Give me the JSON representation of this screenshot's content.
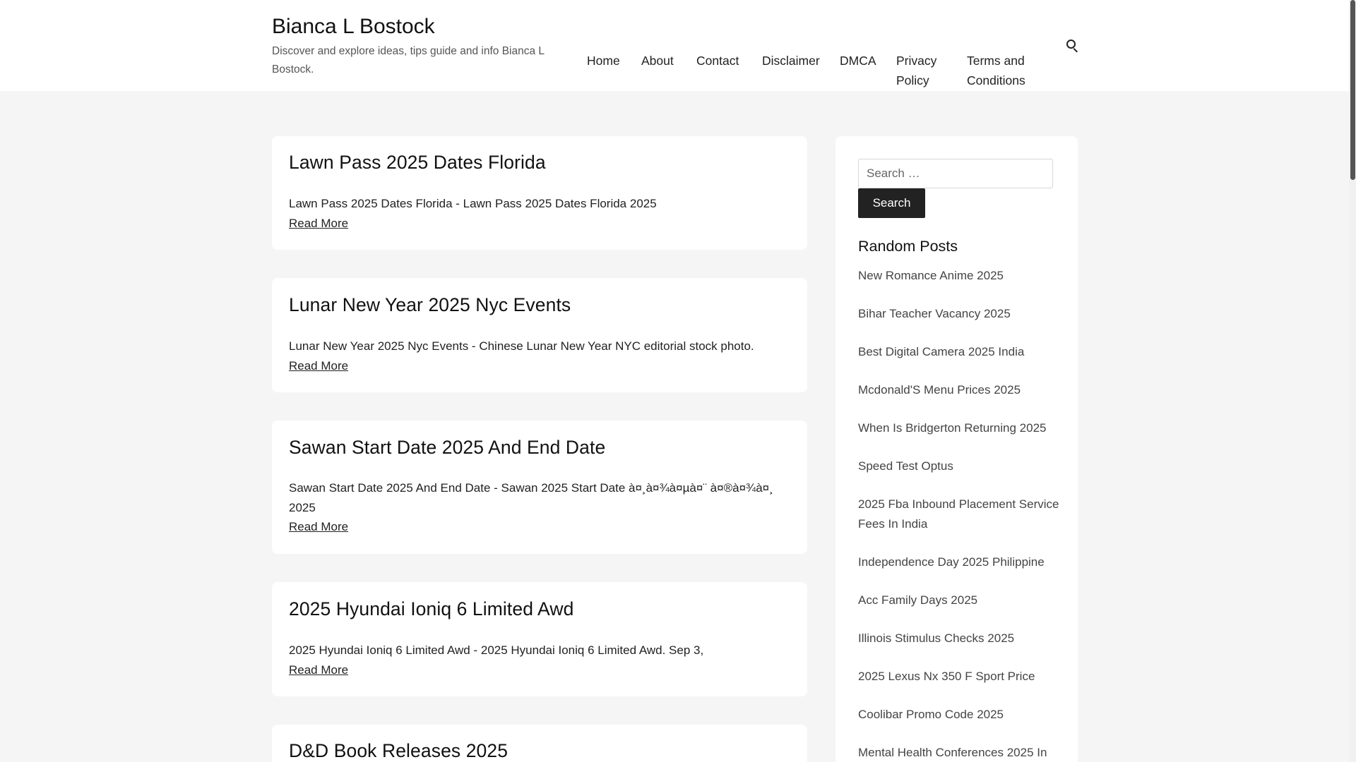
{
  "site": {
    "title": "Bianca L Bostock",
    "tagline": "Discover and explore ideas, tips guide and info Bianca L Bostock."
  },
  "nav": {
    "home": "Home",
    "about": "About",
    "contact": "Contact",
    "disclaimer": "Disclaimer",
    "dmca": "DMCA",
    "privacy": "Privacy Policy",
    "terms": "Terms and Conditions",
    "search_icon": "search-icon"
  },
  "posts": [
    {
      "title": "Lawn Pass 2025 Dates Florida",
      "excerpt": "Lawn Pass 2025 Dates Florida - Lawn Pass 2025 Dates Florida 2025",
      "read_more": "Read More"
    },
    {
      "title": "Lunar New Year 2025 Nyc Events",
      "excerpt": "Lunar New Year 2025 Nyc Events - Chinese Lunar New Year NYC editorial stock photo.",
      "read_more": "Read More"
    },
    {
      "title": "Sawan Start Date 2025 And End Date",
      "excerpt": "Sawan Start Date 2025 And End Date - Sawan 2025 Start Date à¤¸à¤¾à¤µà¤¨ à¤®à¤¾à¤¸ 2025",
      "read_more": "Read More"
    },
    {
      "title": "2025 Hyundai Ioniq 6 Limited Awd",
      "excerpt": "2025 Hyundai Ioniq 6 Limited Awd - 2025 Hyundai Ioniq 6 Limited Awd. Sep 3,",
      "read_more": "Read More"
    },
    {
      "title": "D&D Book Releases 2025"
    }
  ],
  "sidebar": {
    "search_placeholder": "Search …",
    "search_button": "Search",
    "random_posts_title": "Random Posts",
    "random_posts": [
      "New Romance Anime 2025",
      "Bihar Teacher Vacancy 2025",
      "Best Digital Camera 2025 India",
      "Mcdonald'S Menu Prices 2025",
      "When Is Bridgerton Returning 2025",
      "Speed Test Optus",
      "2025 Fba Inbound Placement Service Fees In India",
      "Independence Day 2025 Philippine",
      "Acc Family Days 2025",
      "Illinois Stimulus Checks 2025",
      "2025 Lexus Nx 350 F Sport Price",
      "Coolibar Promo Code 2025",
      "Mental Health Conferences 2025 In"
    ]
  },
  "colors": {
    "page_bg": "#f5f5f5",
    "card_bg": "#ffffff",
    "button_bg": "#222222",
    "text": "#222222"
  }
}
